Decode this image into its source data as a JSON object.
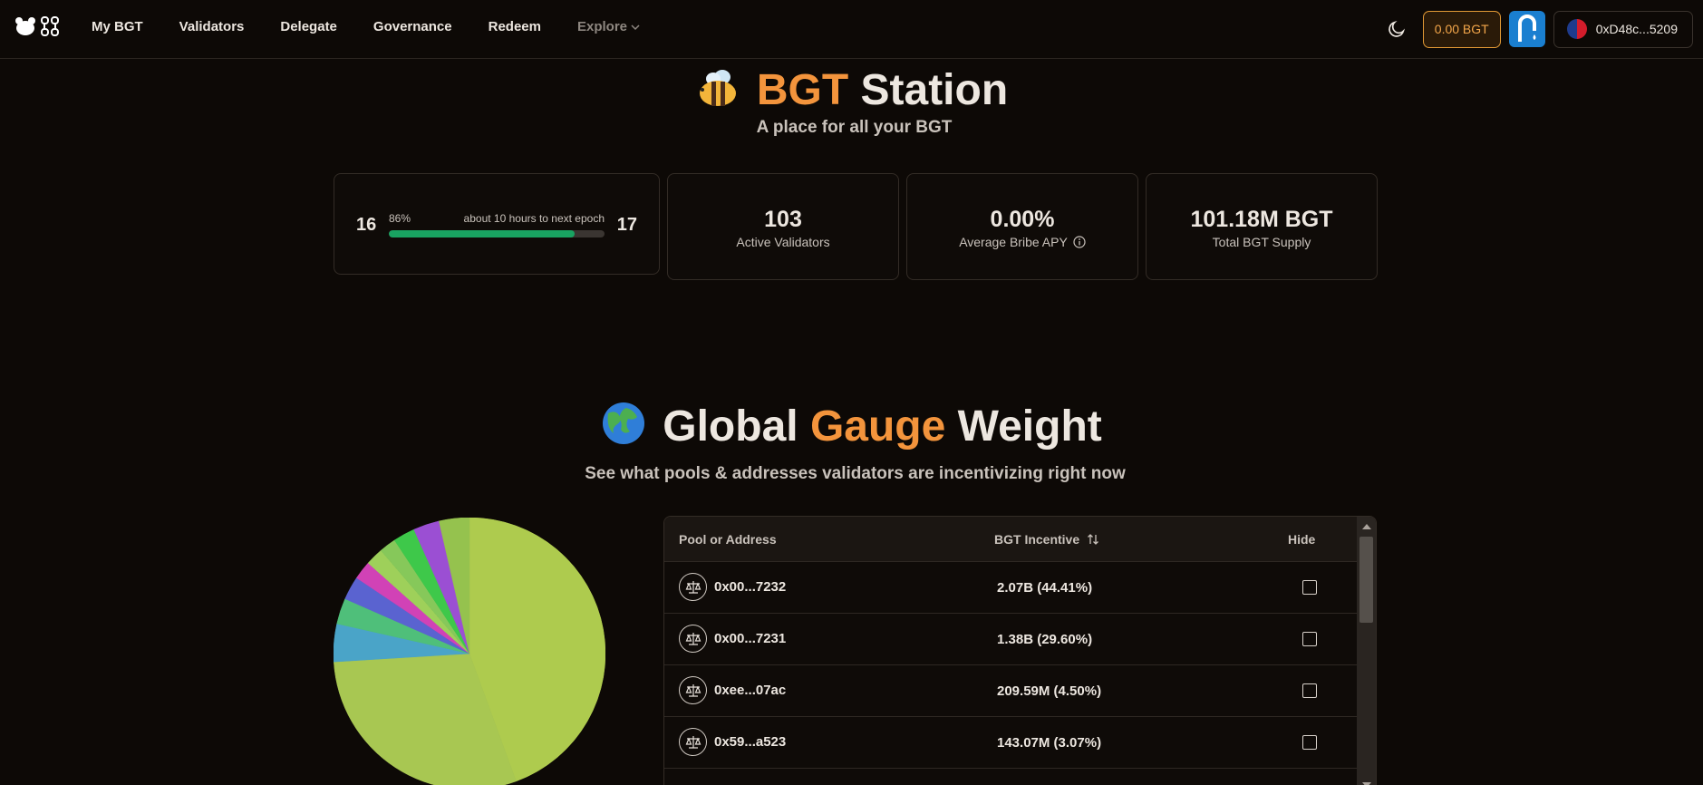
{
  "nav": {
    "links": [
      "My BGT",
      "Validators",
      "Delegate",
      "Governance",
      "Redeem"
    ],
    "explore_label": "Explore",
    "bgt_balance": "0.00 BGT",
    "wallet_address": "0xD48c...5209"
  },
  "hero": {
    "title_highlight": "BGT",
    "title_rest": "Station",
    "subtitle": "A place for all your BGT"
  },
  "epoch": {
    "current": "16",
    "next": "17",
    "progress_label": "86%",
    "progress": 0.86,
    "next_epoch_text": "about 10 hours to next epoch"
  },
  "stats": [
    {
      "value": "103",
      "label": "Active Validators"
    },
    {
      "value": "0.00%",
      "label": "Average Bribe APY"
    },
    {
      "value": "101.18M BGT",
      "label": "Total BGT Supply"
    }
  ],
  "gauge": {
    "title_start": "Global",
    "title_highlight": "Gauge",
    "title_end": "Weight",
    "subtitle": "See what pools & addresses validators are incentivizing right now"
  },
  "table": {
    "headers": {
      "pool": "Pool or Address",
      "incentive": "BGT Incentive",
      "hide": "Hide"
    },
    "rows": [
      {
        "address": "0x00...7232",
        "incentive": "2.07B (44.41%)"
      },
      {
        "address": "0x00...7231",
        "incentive": "1.38B (29.60%)"
      },
      {
        "address": "0xee...07ac",
        "incentive": "209.59M (4.50%)"
      },
      {
        "address": "0x59...a523",
        "incentive": "143.07M (3.07%)"
      }
    ]
  },
  "colors": {
    "accent_orange": "#f3943c",
    "progress_green": "#19a361"
  },
  "pie_data": [
    {
      "value": 44.41,
      "color": "#aecb4e"
    },
    {
      "value": 29.6,
      "color": "#a8c752"
    },
    {
      "value": 4.5,
      "color": "#4aa4c8"
    },
    {
      "value": 3.07,
      "color": "#4fbf7a"
    },
    {
      "value": 2.8,
      "color": "#5a63d0"
    },
    {
      "value": 2.2,
      "color": "#d142b6"
    },
    {
      "value": 2.1,
      "color": "#9ed05a"
    },
    {
      "value": 2.0,
      "color": "#86c85a"
    },
    {
      "value": 2.6,
      "color": "#3ec84a"
    },
    {
      "value": 3.1,
      "color": "#9b4fd3"
    },
    {
      "value": 3.6,
      "color": "#95c24e"
    }
  ]
}
